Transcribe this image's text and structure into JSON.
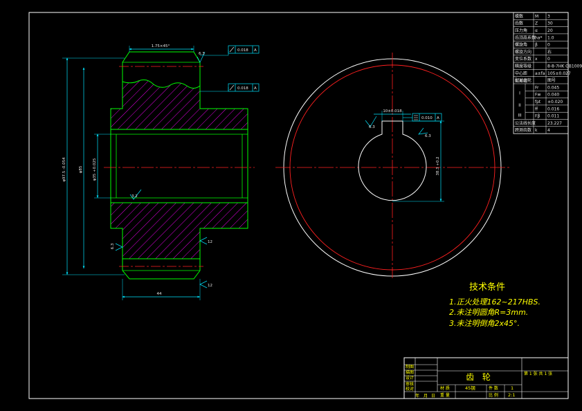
{
  "colors": {
    "frame": "#ffffff",
    "green": "#00ff00",
    "cyan": "#00e5ff",
    "magenta": "#ff00ff",
    "red": "#ff2020",
    "yellow": "#ffff00",
    "text": "#e8e8e8"
  },
  "param_table": {
    "rows": [
      {
        "name": "模数",
        "sym": "M",
        "val": "3"
      },
      {
        "name": "齿数",
        "sym": "Z",
        "val": "30"
      },
      {
        "name": "压力角",
        "sym": "α",
        "val": "20"
      },
      {
        "name": "齿顶高系数",
        "sym": "ha*",
        "val": "1.0"
      },
      {
        "name": "螺旋角",
        "sym": "β",
        "val": "0"
      },
      {
        "name": "螺旋方向",
        "sym": "",
        "val": "右"
      },
      {
        "name": "变位系数",
        "sym": "x",
        "val": "0"
      },
      {
        "name": "精度等级",
        "sym": "",
        "val": "8-8-7HK GB10095-88"
      },
      {
        "name": "中心距",
        "sym": "a±fa",
        "val": "105±0.027"
      },
      {
        "name": "配对齿轮",
        "sym": "",
        "val": "图号"
      },
      {
        "name": "",
        "sym": "Fr",
        "val": "0.045"
      },
      {
        "name": "",
        "sym": "Fw",
        "val": "0.040"
      },
      {
        "name": "",
        "sym": "fpt",
        "val": "±0.020"
      },
      {
        "name": "",
        "sym": "ff",
        "val": "0.016"
      },
      {
        "name": "",
        "sym": "Fβ",
        "val": "0.011"
      },
      {
        "name": "公法线长度",
        "sym": "",
        "val": "23.227"
      },
      {
        "name": "跨测齿数",
        "sym": "k",
        "val": "4"
      }
    ],
    "groups": [
      "公差组",
      "I",
      "II",
      "III"
    ]
  },
  "side_view": {
    "chamfer_label": "1.75×45°",
    "tol_top": "0.018",
    "tol_top_ref": "A",
    "tol_mid": "0.018",
    "tol_mid_ref": "A",
    "rough_top": "6.3",
    "rough_bore": "3.2",
    "rough_face_left": "6.3",
    "rough_face_right": "12",
    "rough_bottom": "12",
    "dim_da": "φ97.5 -0.054",
    "dim_d": "φ85",
    "dim_bore": "φ35 +0.025",
    "dim_width": "44"
  },
  "front_view": {
    "keyway_dim": "10±0.018",
    "keyway_tol": "0.010",
    "keyway_tol_ref": "A",
    "keyway_depth": "38.3 +0.2",
    "rough_key": "6.3",
    "rough_key2": "6.3"
  },
  "notes": {
    "title": "技术条件",
    "items": [
      "1.正火处理162~217HBS.",
      "2.未注明圆角R=3mm.",
      "3.未注明倒角2x45°."
    ]
  },
  "title_block": {
    "part_name": "齿  轮",
    "material_label": "材 质",
    "material": "45钢",
    "scale_label": "比 例",
    "scale": "2:1",
    "count_label": "件 数",
    "count": "1",
    "weight_label": "重 量",
    "sheet": "第 1 张  共 1 张",
    "roles": [
      "制图",
      "描图",
      "设计",
      "审核",
      "校对"
    ],
    "date_row": [
      "年",
      "月",
      "日"
    ]
  }
}
